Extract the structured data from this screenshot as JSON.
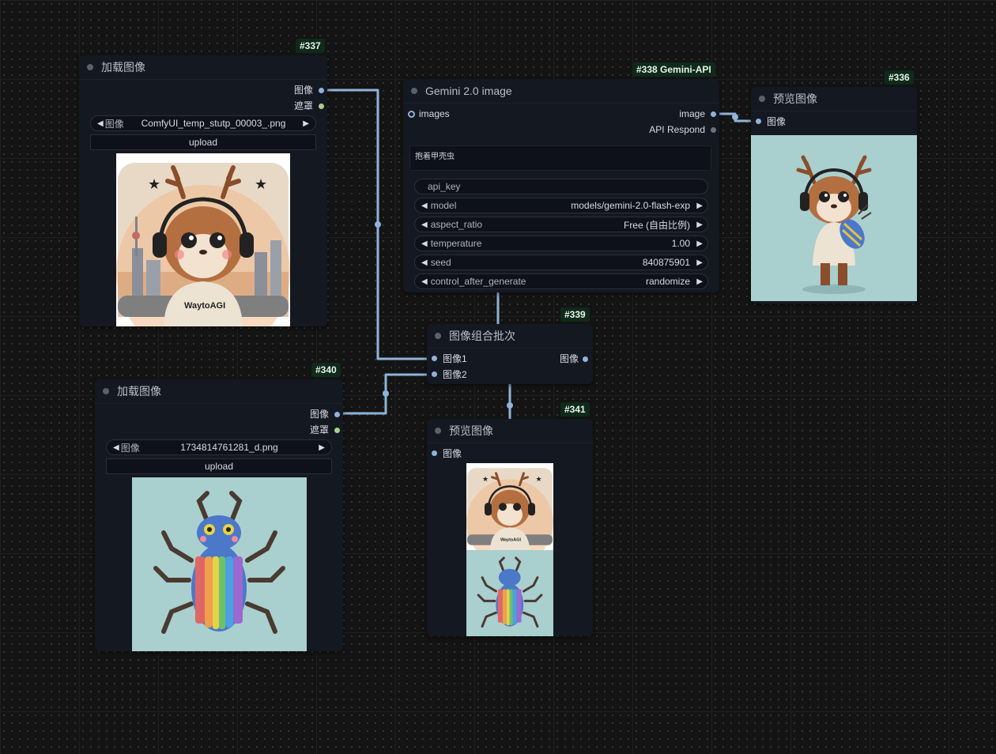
{
  "nodes": {
    "n337": {
      "badge": "#337",
      "title": "加载图像",
      "out_image": "图像",
      "out_mask": "遮罩",
      "file_label": "图像",
      "file_value": "ComfyUI_temp_stutp_00003_.png",
      "upload": "upload",
      "image_text": "WaytoAGI"
    },
    "n338": {
      "badge": "#338 Gemini-API",
      "title": "Gemini 2.0 image",
      "in_images": "images",
      "out_image": "image",
      "out_api": "API Respond",
      "prompt": "抱着甲壳虫",
      "api_key": "api_key",
      "model_label": "model",
      "model_value": "models/gemini-2.0-flash-exp",
      "aspect_label": "aspect_ratio",
      "aspect_value": "Free (自由比例)",
      "temp_label": "temperature",
      "temp_value": "1.00",
      "seed_label": "seed",
      "seed_value": "840875901",
      "cag_label": "control_after_generate",
      "cag_value": "randomize"
    },
    "n336": {
      "badge": "#336",
      "title": "预览图像",
      "in_image": "图像"
    },
    "n339": {
      "badge": "#339",
      "title": "图像组合批次",
      "in_image1": "图像1",
      "in_image2": "图像2",
      "out_image": "图像"
    },
    "n340": {
      "badge": "#340",
      "title": "加载图像",
      "out_image": "图像",
      "out_mask": "遮罩",
      "file_label": "图像",
      "file_value": "1734814761281_d.png",
      "upload": "upload"
    },
    "n341": {
      "badge": "#341",
      "title": "预览图像",
      "in_image": "图像",
      "image_text": "WaytoAGI"
    }
  },
  "colors": {
    "wire_image": "#8fb3d9",
    "port_mask": "#a6d18a",
    "node_bg": "#141821",
    "canvas_bg": "#141414",
    "badge_bg": "#0f2a1a"
  }
}
